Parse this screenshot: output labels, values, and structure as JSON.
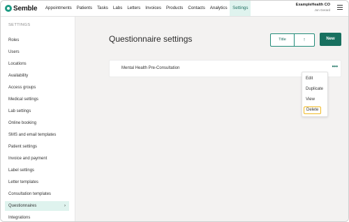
{
  "app": {
    "brand": "Semble"
  },
  "topnav": {
    "items": [
      {
        "label": "Appointments"
      },
      {
        "label": "Patients"
      },
      {
        "label": "Tasks"
      },
      {
        "label": "Labs"
      },
      {
        "label": "Letters"
      },
      {
        "label": "Invoices"
      },
      {
        "label": "Products"
      },
      {
        "label": "Contacts"
      },
      {
        "label": "Analytics"
      },
      {
        "label": "Settings",
        "active": true
      }
    ],
    "account_org": "ExampleHealth CO",
    "account_user": "Jon Gerard",
    "menu_icon": "hamburger-icon"
  },
  "sidebar": {
    "heading": "SETTINGS",
    "items": [
      {
        "label": "Roles"
      },
      {
        "label": "Users"
      },
      {
        "label": "Locations"
      },
      {
        "label": "Availability"
      },
      {
        "label": "Access groups"
      },
      {
        "label": "Medical settings"
      },
      {
        "label": "Lab settings"
      },
      {
        "label": "Online booking"
      },
      {
        "label": "SMS and email templates"
      },
      {
        "label": "Patient settings"
      },
      {
        "label": "Invoice and payment"
      },
      {
        "label": "Label settings"
      },
      {
        "label": "Letter templates"
      },
      {
        "label": "Consultation templates"
      },
      {
        "label": "Questionnaires",
        "active": true,
        "chevron": "›"
      },
      {
        "label": "Integrations"
      }
    ]
  },
  "main": {
    "title": "Questionnaire settings",
    "sort": {
      "field": "Title",
      "direction": "↑"
    },
    "new_label": "New",
    "questionnaires": [
      {
        "title": "Mental Health Pre-Consultation",
        "more": "•••"
      }
    ],
    "row_menu": {
      "items": [
        {
          "label": "Edit"
        },
        {
          "label": "Duplicate"
        },
        {
          "label": "View"
        },
        {
          "label": "Delete",
          "highlighted": true
        }
      ]
    }
  },
  "colors": {
    "brand": "#1f9b84",
    "primary_button": "#17705f",
    "active_bg": "#dff3ee",
    "highlight_outline": "#f0b820",
    "main_bg": "#f3f2f1"
  }
}
